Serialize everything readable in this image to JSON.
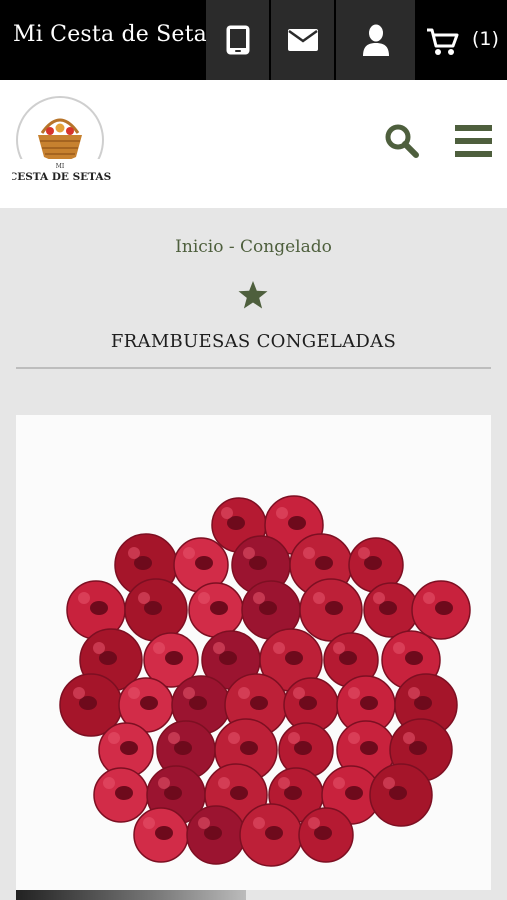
{
  "topbar": {
    "brand": "Mi Cesta de Setas",
    "icons": [
      "phone-icon",
      "mail-icon",
      "user-icon",
      "cart-icon"
    ],
    "cart_count": "(1)"
  },
  "header": {
    "logo_text": "CESTA DE SETAS",
    "logo_small": "MI",
    "icons": [
      "search-icon",
      "menu-icon"
    ]
  },
  "breadcrumb": "Inicio - Congelado",
  "product": {
    "title": "FRAMBUESAS CONGELADAS",
    "favorite_icon": "star-icon",
    "image_subject": "raspberries"
  },
  "colors": {
    "topbar": "#000000",
    "topbar_button": "#2b2b2b",
    "accent_green": "#4e5f3d",
    "background": "#e6e6e6"
  }
}
